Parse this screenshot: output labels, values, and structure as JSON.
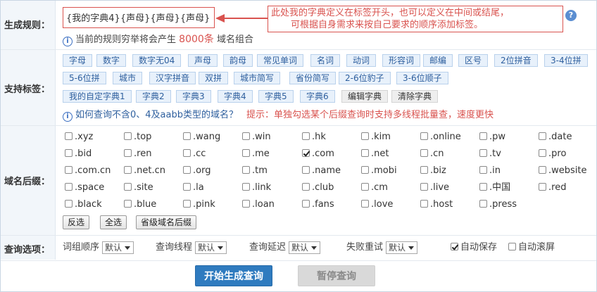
{
  "labels": {
    "rule": "生成规则：",
    "tags": "支持标签：",
    "suffix": "域名后缀：",
    "options": "查询选项："
  },
  "rule": {
    "value": "{我的字典4}{声母}{声母}{声母}",
    "note_line1": "此处我的字典定义在标签开头，也可以定义在中间或结尾，",
    "note_line2": "可根据自身需求来按自己要求的顺序添加标签。",
    "help": "?",
    "count_prefix": "当前的规则穷举将会产生",
    "count": "8000条",
    "count_suffix": "域名组合"
  },
  "tags": {
    "row1": [
      "字母",
      "数字",
      "数字无04",
      "声母",
      "韵母",
      "常见单词",
      "名词",
      "动词",
      "形容词",
      "邮编",
      "区号",
      "2位拼音",
      "3-4位拼"
    ],
    "row2": [
      "5-6位拼",
      "城市",
      "汉字拼音",
      "双拼",
      "城市简写",
      "省份简写",
      "2-6位豹子",
      "3-6位顺子"
    ],
    "row3": [
      "我的自定字典1",
      "字典2",
      "字典3",
      "字典4",
      "字典5",
      "字典6"
    ],
    "edit_dict": "编辑字典",
    "clear_dict": "清除字典",
    "query_link": "如何查询不含0、4及aabb类型的域名？",
    "tip": "提示：单独勾选某个后缀查询时支持多线程批量查，速度更快"
  },
  "suffixes": [
    [
      {
        "t": ".xyz",
        "c": false
      },
      {
        "t": ".top",
        "c": false
      },
      {
        "t": ".wang",
        "c": false
      },
      {
        "t": ".win",
        "c": false
      },
      {
        "t": ".hk",
        "c": false
      },
      {
        "t": ".kim",
        "c": false
      },
      {
        "t": ".online",
        "c": false
      },
      {
        "t": ".pw",
        "c": false
      },
      {
        "t": ".date",
        "c": false
      }
    ],
    [
      {
        "t": ".bid",
        "c": false
      },
      {
        "t": ".ren",
        "c": false
      },
      {
        "t": ".cc",
        "c": false
      },
      {
        "t": ".me",
        "c": false
      },
      {
        "t": ".com",
        "c": true
      },
      {
        "t": ".net",
        "c": false
      },
      {
        "t": ".cn",
        "c": false
      },
      {
        "t": ".tv",
        "c": false
      },
      {
        "t": ".pro",
        "c": false
      }
    ],
    [
      {
        "t": ".com.cn",
        "c": false
      },
      {
        "t": ".net.cn",
        "c": false
      },
      {
        "t": ".org",
        "c": false
      },
      {
        "t": ".tm",
        "c": false
      },
      {
        "t": ".name",
        "c": false
      },
      {
        "t": ".mobi",
        "c": false
      },
      {
        "t": ".biz",
        "c": false
      },
      {
        "t": ".in",
        "c": false
      },
      {
        "t": ".website",
        "c": false
      }
    ],
    [
      {
        "t": ".space",
        "c": false
      },
      {
        "t": ".site",
        "c": false
      },
      {
        "t": ".la",
        "c": false
      },
      {
        "t": ".link",
        "c": false
      },
      {
        "t": ".club",
        "c": false
      },
      {
        "t": ".cm",
        "c": false
      },
      {
        "t": ".live",
        "c": false
      },
      {
        "t": ".中国",
        "c": false
      },
      {
        "t": ".red",
        "c": false
      }
    ],
    [
      {
        "t": ".black",
        "c": false
      },
      {
        "t": ".blue",
        "c": false
      },
      {
        "t": ".pink",
        "c": false
      },
      {
        "t": ".loan",
        "c": false
      },
      {
        "t": ".fans",
        "c": false
      },
      {
        "t": ".love",
        "c": false
      },
      {
        "t": ".host",
        "c": false
      },
      {
        "t": ".press",
        "c": false
      }
    ]
  ],
  "suffix_buttons": {
    "invert": "反选",
    "all": "全选",
    "province": "省级域名后缀"
  },
  "options": {
    "order_label": "词组顺序",
    "order_value": "默认",
    "threads_label": "查询线程",
    "threads_value": "默认",
    "delay_label": "查询延迟",
    "delay_value": "默认",
    "retry_label": "失败重试",
    "retry_value": "默认",
    "autosave_label": "自动保存",
    "autosave_checked": true,
    "autoscroll_label": "自动滚屏",
    "autoscroll_checked": false
  },
  "actions": {
    "start": "开始生成查询",
    "pause": "暂停查询"
  },
  "colors": {
    "accent_red": "#d9534f",
    "primary_blue": "#2f7bbf",
    "tag_blue": "#2e5f9e"
  }
}
